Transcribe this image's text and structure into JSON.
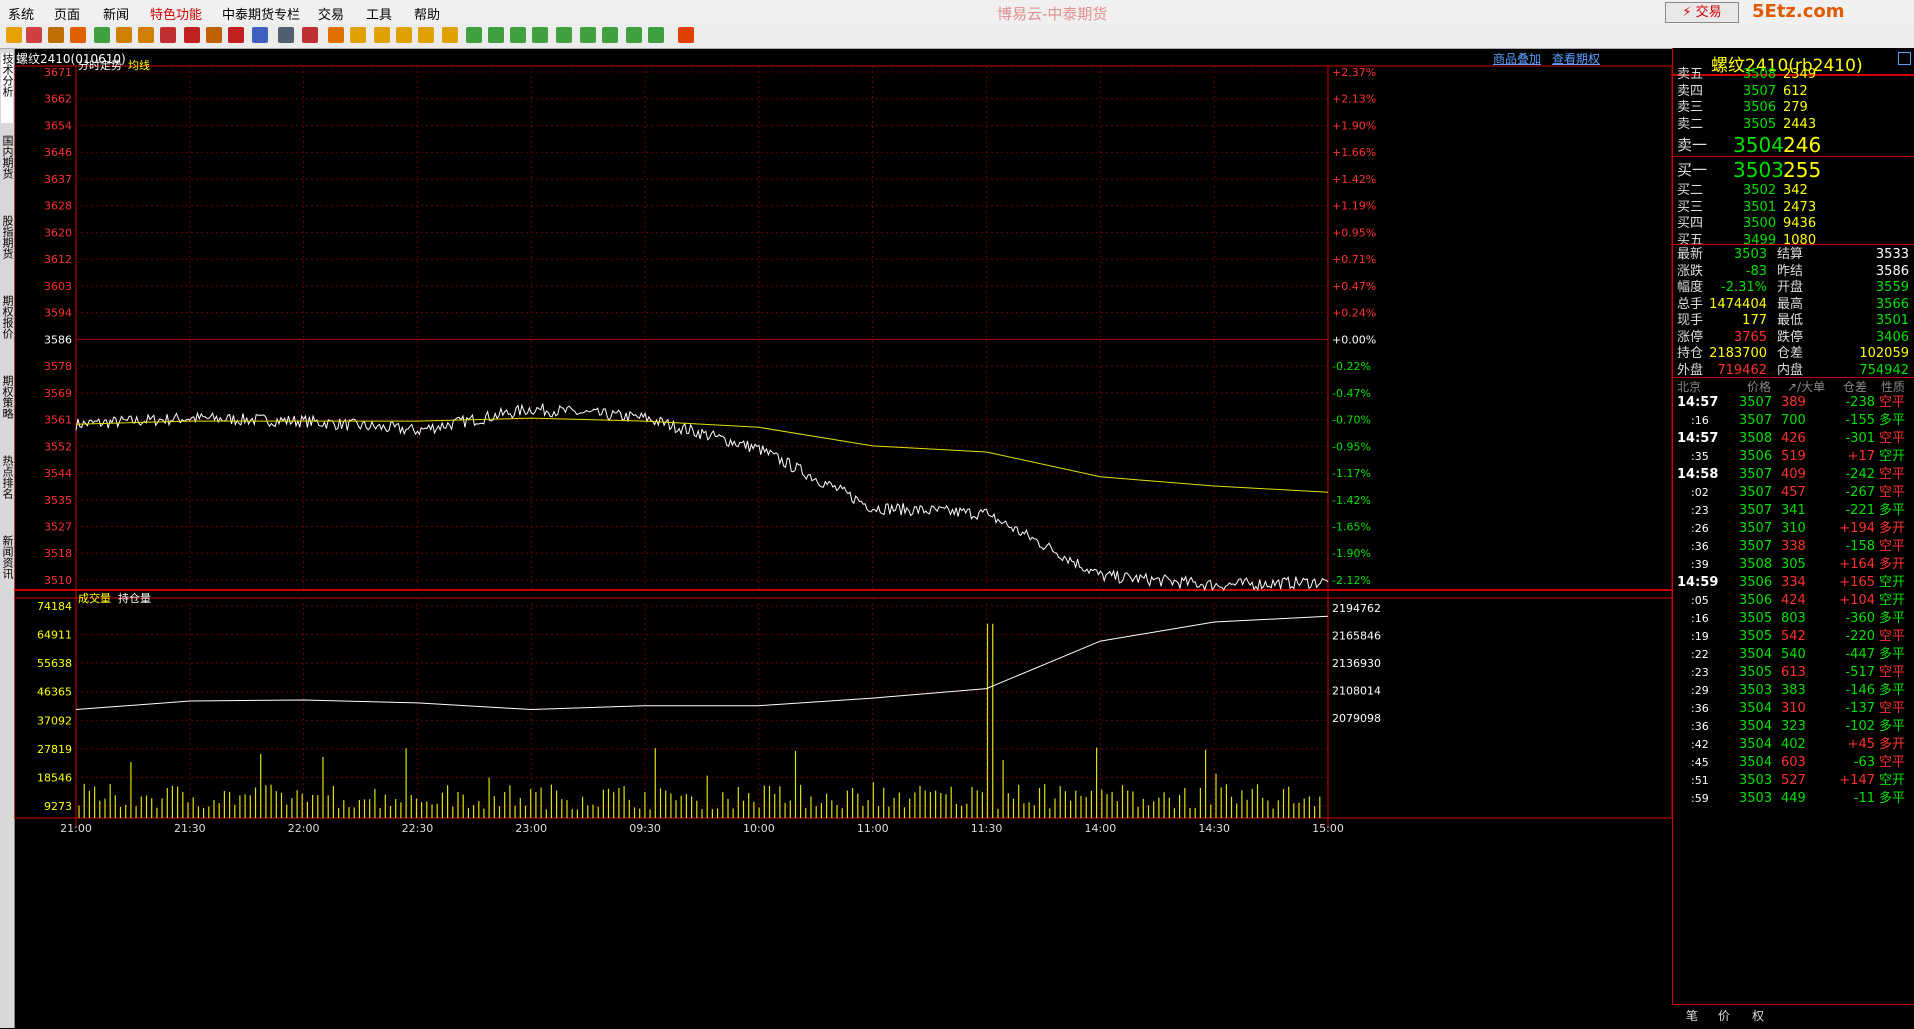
{
  "menu": [
    "系统",
    "页面",
    "新闻",
    "特色功能",
    "中泰期货专栏",
    "交易",
    "工具",
    "帮助"
  ],
  "menu_active_index": 3,
  "window_title": "博易云-中泰期货",
  "trade_button": "⚡ 交易",
  "logo": "5Etz.com",
  "symbol_line": "螺纹2410(010610)",
  "links": {
    "overlay": "商品叠加",
    "options": "查看期权"
  },
  "side_tabs": [
    "技术分析",
    "国内期货",
    "股指期货",
    "期权报价",
    "期权策略",
    "热点排名",
    "新闻资讯"
  ],
  "price_chart": {
    "legend": [
      "分时走势",
      "均线"
    ],
    "left_ticks": [
      "3671",
      "3662",
      "3654",
      "3646",
      "3637",
      "3628",
      "3620",
      "3612",
      "3603",
      "3594",
      "3586",
      "3578",
      "3569",
      "3561",
      "3552",
      "3544",
      "3535",
      "3527",
      "3518",
      "3510"
    ],
    "right_ticks": [
      "+2.37%",
      "+2.13%",
      "+1.90%",
      "+1.66%",
      "+1.42%",
      "+1.19%",
      "+0.95%",
      "+0.71%",
      "+0.47%",
      "+0.24%",
      "+0.00%",
      "-0.22%",
      "-0.47%",
      "-0.70%",
      "-0.95%",
      "-1.17%",
      "-1.42%",
      "-1.65%",
      "-1.90%",
      "-2.12%"
    ]
  },
  "volume_chart": {
    "legend": [
      "成交量",
      "持仓量"
    ],
    "left_ticks": [
      "74184",
      "64911",
      "55638",
      "46365",
      "37092",
      "27819",
      "18546",
      "9273"
    ],
    "right_ticks": [
      "2194762",
      "2165846",
      "2136930",
      "2108014",
      "2079098"
    ]
  },
  "time_axis": [
    "21:00",
    "21:30",
    "22:00",
    "22:30",
    "23:00",
    "09:30",
    "10:00",
    "11:00",
    "11:30",
    "14:00",
    "14:30",
    "15:00"
  ],
  "chart_data": {
    "type": "line",
    "ylim": [
      3504,
      3671
    ],
    "x": [
      "21:00",
      "21:30",
      "22:00",
      "22:30",
      "23:00",
      "09:30",
      "10:00",
      "11:00",
      "11:30",
      "14:00",
      "14:30",
      "15:00"
    ],
    "series": [
      {
        "name": "分时走势",
        "values": [
          3557,
          3559,
          3558,
          3555,
          3562,
          3559,
          3549,
          3530,
          3528,
          3508,
          3505,
          3506
        ]
      },
      {
        "name": "均线",
        "values": [
          3557,
          3558,
          3558,
          3558,
          3559,
          3558,
          3556,
          3550,
          3548,
          3540,
          3537,
          3535
        ]
      }
    ],
    "volume_ylim": [
      0,
      74184
    ],
    "open_interest": {
      "ylim": [
        2079098,
        2194762
      ],
      "values": [
        2088000,
        2097000,
        2098000,
        2095000,
        2088000,
        2092000,
        2092000,
        2100000,
        2110000,
        2160000,
        2180000,
        2186000
      ]
    }
  },
  "quote": {
    "name": "螺纹2410(rb2410)",
    "asks": [
      {
        "label": "卖五",
        "price": "3508",
        "vol": "2349"
      },
      {
        "label": "卖四",
        "price": "3507",
        "vol": "612"
      },
      {
        "label": "卖三",
        "price": "3506",
        "vol": "279"
      },
      {
        "label": "卖二",
        "price": "3505",
        "vol": "2443"
      },
      {
        "label": "卖一",
        "price": "3504",
        "vol": "246"
      }
    ],
    "bids": [
      {
        "label": "买一",
        "price": "3503",
        "vol": "255"
      },
      {
        "label": "买二",
        "price": "3502",
        "vol": "342"
      },
      {
        "label": "买三",
        "price": "3501",
        "vol": "2473"
      },
      {
        "label": "买四",
        "price": "3500",
        "vol": "9436"
      },
      {
        "label": "买五",
        "price": "3499",
        "vol": "1080"
      }
    ],
    "stats": [
      {
        "l1": "最新",
        "v1": "3503",
        "c1": "grn",
        "l2": "结算",
        "v2": "3533",
        "c2": "wht"
      },
      {
        "l1": "涨跌",
        "v1": "-83",
        "c1": "grn",
        "l2": "昨结",
        "v2": "3586",
        "c2": "wht"
      },
      {
        "l1": "幅度",
        "v1": "-2.31%",
        "c1": "grn",
        "l2": "开盘",
        "v2": "3559",
        "c2": "grn"
      },
      {
        "l1": "总手",
        "v1": "1474404",
        "c1": "ylw",
        "l2": "最高",
        "v2": "3566",
        "c2": "grn"
      },
      {
        "l1": "现手",
        "v1": "177",
        "c1": "ylw",
        "l2": "最低",
        "v2": "3501",
        "c2": "grn"
      },
      {
        "l1": "涨停",
        "v1": "3765",
        "c1": "red",
        "l2": "跌停",
        "v2": "3406",
        "c2": "grn"
      },
      {
        "l1": "持仓",
        "v1": "2183700",
        "c1": "ylw",
        "l2": "仓差",
        "v2": "102059",
        "c2": "ylw"
      },
      {
        "l1": "外盘",
        "v1": "719462",
        "c1": "red",
        "l2": "内盘",
        "v2": "754942",
        "c2": "grn"
      }
    ],
    "tick_header": [
      "北京",
      "价格",
      "↗/大单",
      "仓差",
      "性质"
    ],
    "ticks": [
      {
        "t": "14:57",
        "p": "3507",
        "v": "389",
        "d": "-238",
        "n": "空平",
        "big": true
      },
      {
        "t": ":16",
        "p": "3507",
        "v": "700",
        "d": "-155",
        "n": "多平",
        "big": false
      },
      {
        "t": "14:57",
        "p": "3508",
        "v": "426",
        "d": "-301",
        "n": "空平",
        "big": true
      },
      {
        "t": ":35",
        "p": "3506",
        "v": "519",
        "d": "+17",
        "n": "空开",
        "big": false
      },
      {
        "t": "14:58",
        "p": "3507",
        "v": "409",
        "d": "-242",
        "n": "空平",
        "big": true
      },
      {
        "t": ":02",
        "p": "3507",
        "v": "457",
        "d": "-267",
        "n": "空平",
        "big": false
      },
      {
        "t": ":23",
        "p": "3507",
        "v": "341",
        "d": "-221",
        "n": "多平",
        "big": false
      },
      {
        "t": ":26",
        "p": "3507",
        "v": "310",
        "d": "+194",
        "n": "多开",
        "big": false
      },
      {
        "t": ":36",
        "p": "3507",
        "v": "338",
        "d": "-158",
        "n": "空平",
        "big": false
      },
      {
        "t": ":39",
        "p": "3508",
        "v": "305",
        "d": "+164",
        "n": "多开",
        "big": false
      },
      {
        "t": "14:59",
        "p": "3506",
        "v": "334",
        "d": "+165",
        "n": "空开",
        "big": true
      },
      {
        "t": ":05",
        "p": "3506",
        "v": "424",
        "d": "+104",
        "n": "空开",
        "big": false
      },
      {
        "t": ":16",
        "p": "3505",
        "v": "803",
        "d": "-360",
        "n": "多平",
        "big": false
      },
      {
        "t": ":19",
        "p": "3505",
        "v": "542",
        "d": "-220",
        "n": "空平",
        "big": false
      },
      {
        "t": ":22",
        "p": "3504",
        "v": "540",
        "d": "-447",
        "n": "多平",
        "big": false
      },
      {
        "t": ":23",
        "p": "3505",
        "v": "613",
        "d": "-517",
        "n": "空平",
        "big": false
      },
      {
        "t": ":29",
        "p": "3503",
        "v": "383",
        "d": "-146",
        "n": "多平",
        "big": false
      },
      {
        "t": ":36",
        "p": "3504",
        "v": "310",
        "d": "-137",
        "n": "空平",
        "big": false
      },
      {
        "t": ":36",
        "p": "3504",
        "v": "323",
        "d": "-102",
        "n": "多平",
        "big": false
      },
      {
        "t": ":42",
        "p": "3504",
        "v": "402",
        "d": "+45",
        "n": "多开",
        "big": false
      },
      {
        "t": ":45",
        "p": "3504",
        "v": "603",
        "d": "-63",
        "n": "空平",
        "big": false
      },
      {
        "t": ":51",
        "p": "3503",
        "v": "527",
        "d": "+147",
        "n": "空开",
        "big": false
      },
      {
        "t": ":59",
        "p": "3503",
        "v": "449",
        "d": "-11",
        "n": "多平",
        "big": false
      }
    ],
    "bottom_tabs": [
      "笔",
      "价",
      "权"
    ]
  }
}
